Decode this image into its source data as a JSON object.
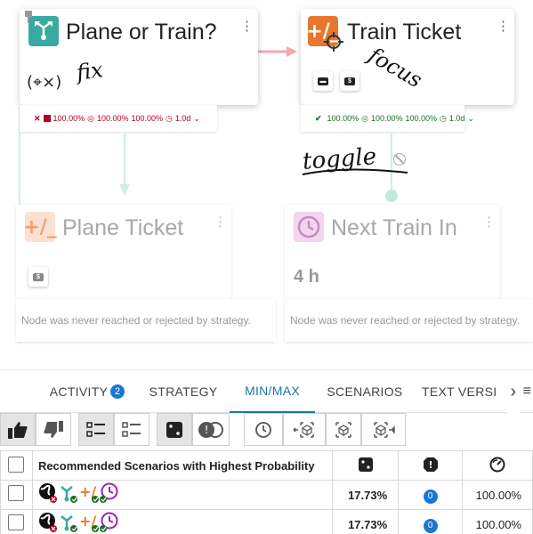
{
  "nodes": {
    "plane_or_train": {
      "title": "Plane or Train?",
      "subtitle": "(⌖×)",
      "annotation": "fix",
      "footer": {
        "percent_a": "100.00%",
        "percent_b": "100.00%",
        "percent_c": "100.00%",
        "duration": "1.0d"
      }
    },
    "train_ticket": {
      "title": "Train Ticket",
      "annotation": "focus",
      "footer": {
        "percent_a": "100.00%",
        "percent_b": "100.00%",
        "percent_c": "100.00%",
        "duration": "1.0d"
      }
    },
    "plane_ticket": {
      "title": "Plane Ticket",
      "footer_note": "Node was never reached or rejected by strategy."
    },
    "next_train_in": {
      "title": "Next Train In",
      "value": "4 h",
      "footer_note": "Node was never reached or rejected by strategy."
    }
  },
  "canvas_annotation": "toggle",
  "tabs": [
    {
      "label": "ACTIVITY",
      "count": "2"
    },
    {
      "label": "STRATEGY"
    },
    {
      "label": "MIN/MAX"
    },
    {
      "label": "SCENARIOS"
    },
    {
      "label": "TEXT VERSI"
    }
  ],
  "tab_scroll_right": "›",
  "tab_menu": "≡",
  "table": {
    "header": "Recommended Scenarios with Highest Probability",
    "rows": [
      {
        "probability": "17.73%",
        "risk_count": "0",
        "confidence": "100.00%"
      },
      {
        "probability": "17.73%",
        "risk_count": "0",
        "confidence": "100.00%"
      }
    ]
  },
  "colors": {
    "accent": "#1976a8",
    "teal": "#3aa99f",
    "orange": "#e8772e",
    "purple": "#9c27b0",
    "red": "#b00020",
    "green": "#1b6e20",
    "pink_edge": "#f4a6b5"
  }
}
